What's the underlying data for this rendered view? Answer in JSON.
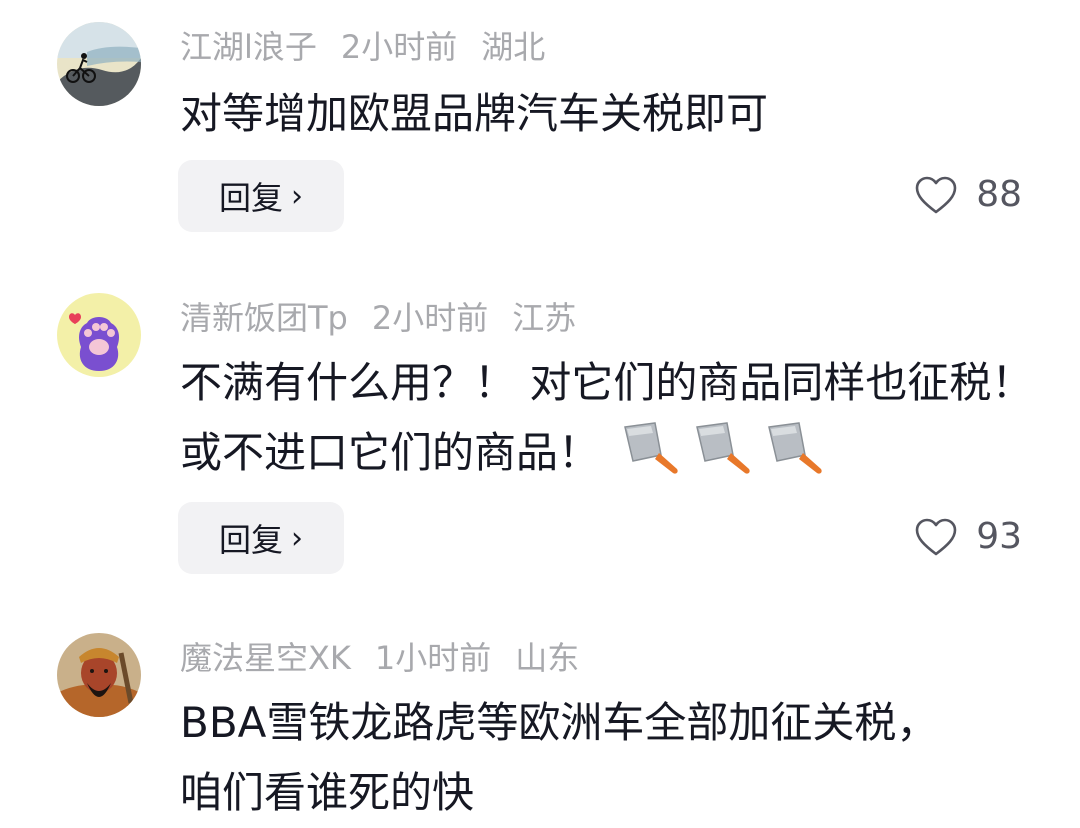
{
  "comments": [
    {
      "username": "江湖l浪子",
      "time": "2小时前",
      "location": "湖北",
      "text": "对等增加欧盟品牌汽车关税即可",
      "reply_label": "回复",
      "likes": "88",
      "avatar_icon": "cyclist-avatar-icon"
    },
    {
      "username": "清新饭团Tp",
      "time": "2小时前",
      "location": "江苏",
      "text": "不满有什么用？！ 对它们的商品同样也征税！或不进口它们的商品！",
      "emoji_icon": "kitchen-knife-icon",
      "emoji_count": 3,
      "reply_label": "回复",
      "likes": "93",
      "avatar_icon": "cat-paw-avatar-icon"
    },
    {
      "username": "魔法星空XK",
      "time": "1小时前",
      "location": "山东",
      "text": "BBA雪铁龙路虎等欧洲车全部加征关税，咱们看谁死的快",
      "avatar_icon": "guan-yu-avatar-icon"
    }
  ],
  "colors": {
    "meta_text": "#a8a9ad",
    "body_text": "#161823",
    "reply_bg": "#f2f2f4"
  }
}
